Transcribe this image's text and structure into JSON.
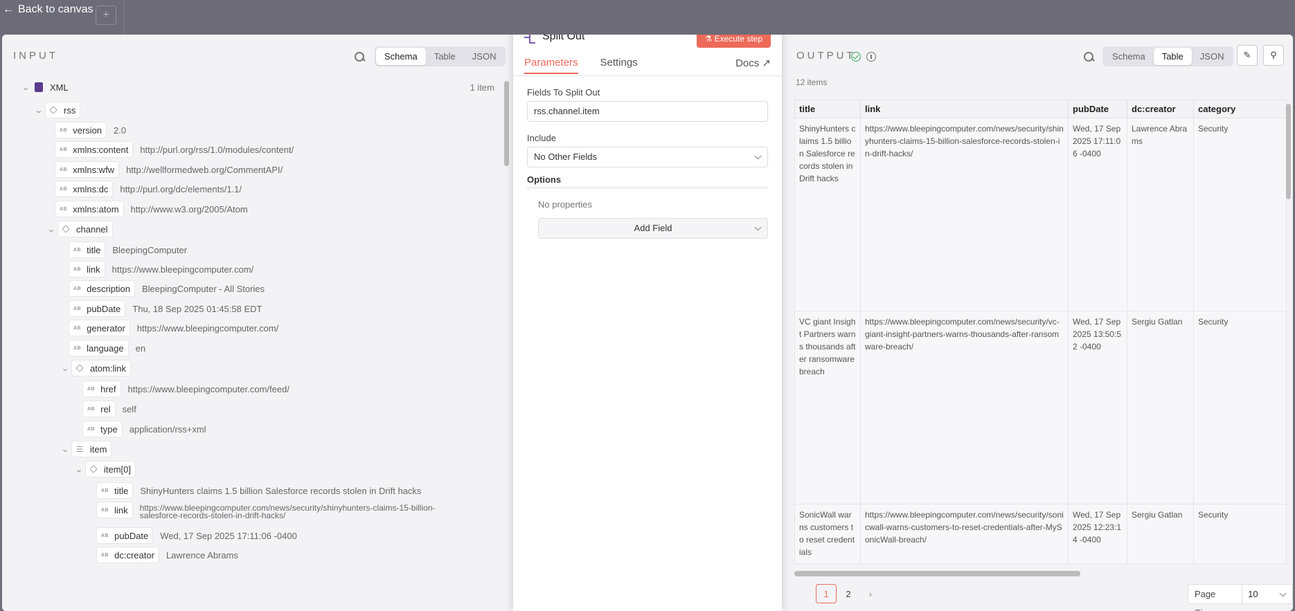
{
  "canvas": {
    "back_label": "Back to canvas",
    "plus_label": "+"
  },
  "input": {
    "title": "INPUT",
    "view_tabs": [
      "Schema",
      "Table",
      "JSON"
    ],
    "root": {
      "name": "XML",
      "count": "1 item"
    },
    "tree": [
      {
        "key": "rss",
        "type": "object",
        "value": ""
      },
      {
        "key": "version",
        "type": "string",
        "value": "2.0"
      },
      {
        "key": "xmlns:content",
        "type": "string",
        "value": "http://purl.org/rss/1.0/modules/content/"
      },
      {
        "key": "xmlns:wfw",
        "type": "string",
        "value": "http://wellformedweb.org/CommentAPI/"
      },
      {
        "key": "xmlns:dc",
        "type": "string",
        "value": "http://purl.org/dc/elements/1.1/"
      },
      {
        "key": "xmlns:atom",
        "type": "string",
        "value": "http://www.w3.org/2005/Atom"
      },
      {
        "key": "channel",
        "type": "object",
        "value": ""
      },
      {
        "key": "title",
        "type": "string",
        "value": "BleepingComputer"
      },
      {
        "key": "link",
        "type": "string",
        "value": "https://www.bleepingcomputer.com/"
      },
      {
        "key": "description",
        "type": "string",
        "value": "BleepingComputer - All Stories"
      },
      {
        "key": "pubDate",
        "type": "string",
        "value": "Thu, 18 Sep 2025 01:45:58 EDT"
      },
      {
        "key": "generator",
        "type": "string",
        "value": "https://www.bleepingcomputer.com/"
      },
      {
        "key": "language",
        "type": "string",
        "value": "en"
      },
      {
        "key": "atom:link",
        "type": "object",
        "value": ""
      },
      {
        "key": "href",
        "type": "string",
        "value": "https://www.bleepingcomputer.com/feed/"
      },
      {
        "key": "rel",
        "type": "string",
        "value": "self"
      },
      {
        "key": "type",
        "type": "string",
        "value": "application/rss+xml"
      },
      {
        "key": "item",
        "type": "list",
        "value": ""
      },
      {
        "key": "item[0]",
        "type": "object",
        "value": ""
      },
      {
        "key": "title",
        "type": "string",
        "value": "ShinyHunters claims 1.5 billion Salesforce records stolen in Drift hacks"
      },
      {
        "key": "link",
        "type": "string",
        "value": "https://www.bleepingcomputer.com/news/security/shinyhunters-claims-15-billion-",
        "value2": "salesforce-records-stolen-in-drift-hacks/"
      },
      {
        "key": "pubDate",
        "type": "string",
        "value": "Wed, 17 Sep 2025 17:11:06 -0400"
      },
      {
        "key": "dc:creator",
        "type": "string",
        "value": "Lawrence Abrams"
      }
    ]
  },
  "node": {
    "title": "Split Out",
    "execute_label": "Execute step",
    "tabs": [
      "Parameters",
      "Settings"
    ],
    "docs_label": "Docs ↗",
    "fields_label": "Fields To Split Out",
    "fields_value": "rss.channel.item",
    "include_label": "Include",
    "include_value": "No Other Fields",
    "options_label": "Options",
    "no_props": "No properties",
    "add_field": "Add Field"
  },
  "output": {
    "title": "OUTPUT",
    "view_tabs": [
      "Schema",
      "Table",
      "JSON"
    ],
    "items_count": "12 items",
    "columns": [
      "title",
      "link",
      "pubDate",
      "dc:creator",
      "category"
    ],
    "rows": [
      [
        "ShinyHunters claims 1.5 billion Salesforce records stolen in Drift hacks",
        "https://www.bleepingcomputer.com/news/security/shinyhunters-claims-15-billion-salesforce-records-stolen-in-drift-hacks/",
        "Wed, 17 Sep 2025 17:11:06 -0400",
        "Lawrence Abrams",
        "Security"
      ],
      [
        "VC giant Insight Partners warns thousands after ransomware breach",
        "https://www.bleepingcomputer.com/news/security/vc-giant-insight-partners-warns-thousands-after-ransomware-breach/",
        "Wed, 17 Sep 2025 13:50:52 -0400",
        "Sergiu Gatlan",
        "Security"
      ],
      [
        "SonicWall warns customers to reset credentials",
        "https://www.bleepingcomputer.com/news/security/sonicwall-warns-customers-to-reset-credentials-after-MySonicWall-breach/",
        "Wed, 17 Sep 2025 12:23:14 -0400",
        "Sergiu Gatlan",
        "Security"
      ]
    ],
    "pages": [
      "1",
      "2"
    ],
    "next_label": "›",
    "page_size_label": "Page Size",
    "page_size_value": "10"
  }
}
